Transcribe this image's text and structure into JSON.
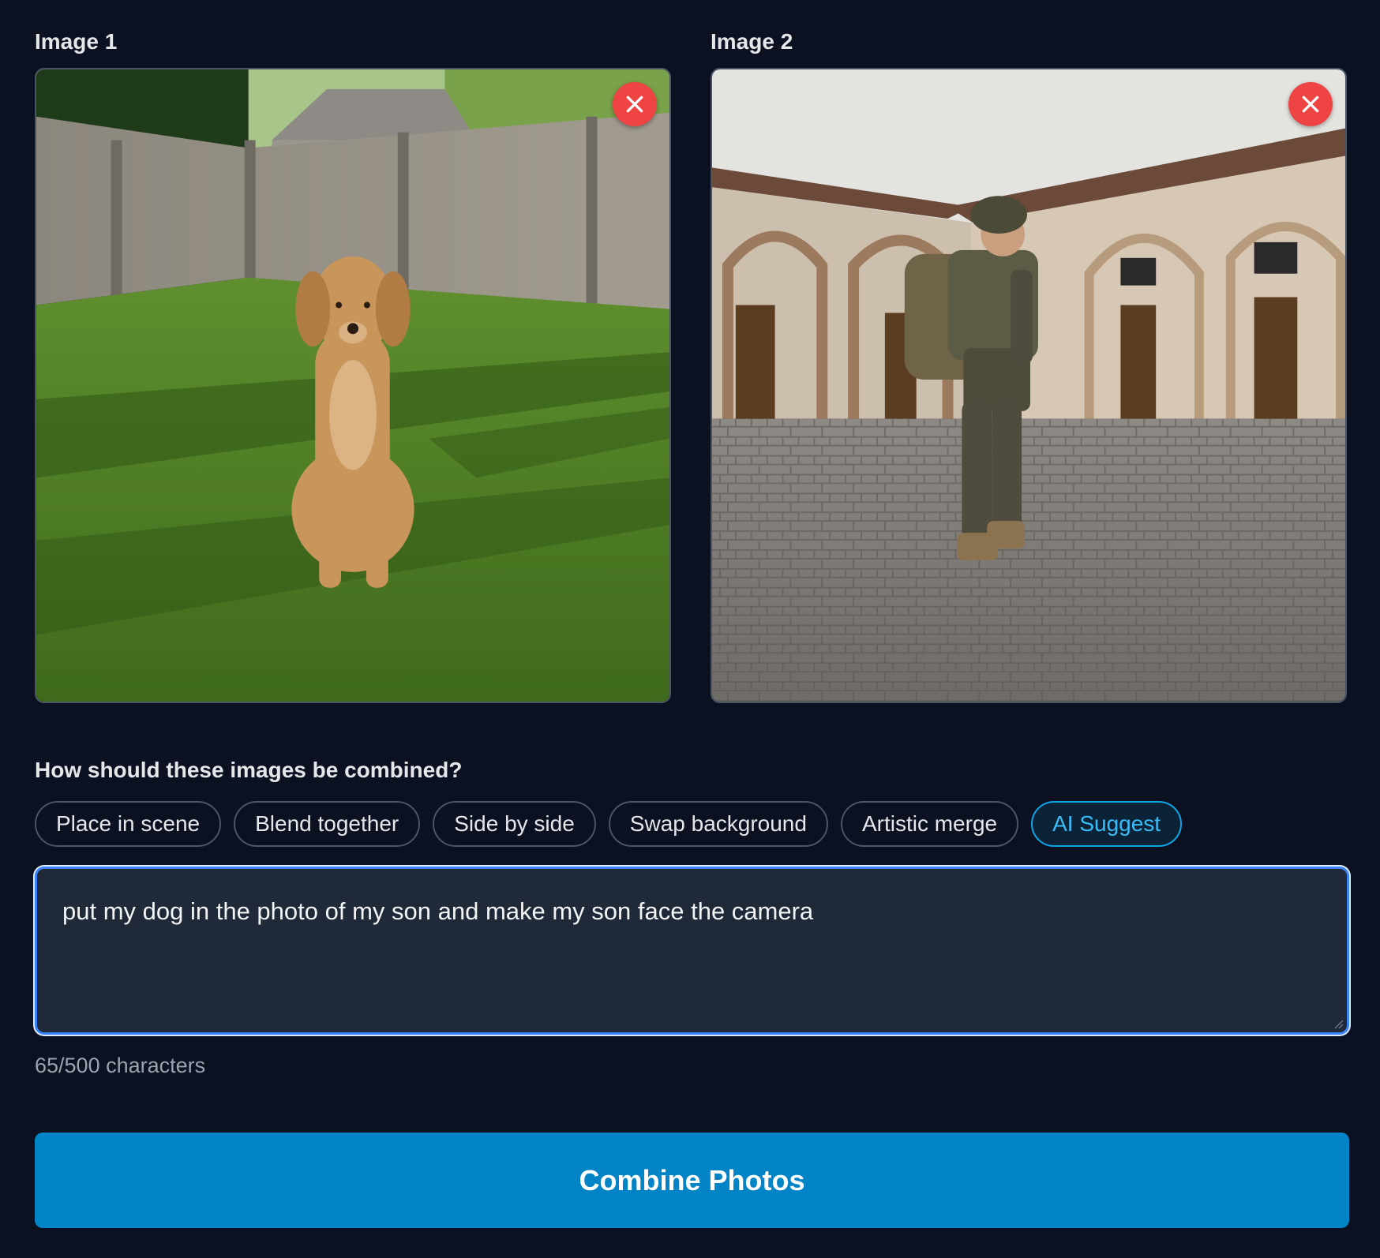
{
  "images": [
    {
      "label": "Image 1",
      "subject": "golden retriever sitting on backyard lawn"
    },
    {
      "label": "Image 2",
      "subject": "soldier standing in cobblestone courtyard"
    }
  ],
  "combine": {
    "question": "How should these images be combined?",
    "options": [
      {
        "label": "Place in scene",
        "active": false
      },
      {
        "label": "Blend together",
        "active": false
      },
      {
        "label": "Side by side",
        "active": false
      },
      {
        "label": "Swap background",
        "active": false
      },
      {
        "label": "Artistic merge",
        "active": false
      },
      {
        "label": "AI Suggest",
        "active": true
      }
    ]
  },
  "prompt": {
    "value": "put my dog in the photo of my son and make my son face the camera",
    "char_count": "65/500 characters"
  },
  "action": {
    "combine_label": "Combine Photos"
  },
  "colors": {
    "background": "#0b1120",
    "accent": "#0284c7",
    "remove": "#ef4444",
    "active_chip": "#38bdf8"
  },
  "icons": {
    "remove": "close-icon"
  }
}
